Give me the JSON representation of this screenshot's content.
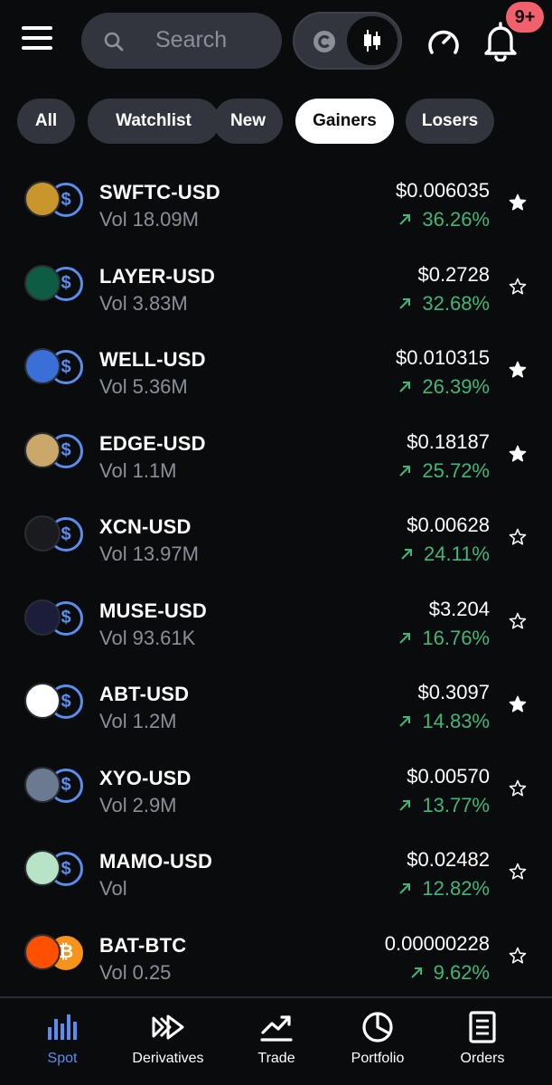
{
  "header": {
    "search_placeholder": "Search",
    "notification_badge": "9+",
    "icons": [
      "menu-icon",
      "search-icon",
      "coin-c-icon",
      "candlestick-icon",
      "gauge-icon",
      "bell-icon"
    ]
  },
  "filters": [
    {
      "label": "All",
      "active": false
    },
    {
      "label": "Watchlist",
      "active": false
    },
    {
      "label": "New",
      "active": false
    },
    {
      "label": "Gainers",
      "active": true
    },
    {
      "label": "Losers",
      "active": false
    }
  ],
  "markets": [
    {
      "pair": "SWFTC-USD",
      "vol_label": "Vol",
      "volume": "18.09M",
      "price": "$0.006035",
      "change": "36.26%",
      "starred": true,
      "coin_color": "#c8962a",
      "quote": "usd"
    },
    {
      "pair": "LAYER-USD",
      "vol_label": "Vol",
      "volume": "3.83M",
      "price": "$0.2728",
      "change": "32.68%",
      "starred": false,
      "coin_color": "#0f5c45",
      "quote": "usd"
    },
    {
      "pair": "WELL-USD",
      "vol_label": "Vol",
      "volume": "5.36M",
      "price": "$0.010315",
      "change": "26.39%",
      "starred": true,
      "coin_color": "#3a6fd8",
      "quote": "usd"
    },
    {
      "pair": "EDGE-USD",
      "vol_label": "Vol",
      "volume": "1.1M",
      "price": "$0.18187",
      "change": "25.72%",
      "starred": true,
      "coin_color": "#c9a86a",
      "quote": "usd"
    },
    {
      "pair": "XCN-USD",
      "vol_label": "Vol",
      "volume": "13.97M",
      "price": "$0.00628",
      "change": "24.11%",
      "starred": false,
      "coin_color": "#1a1b1f",
      "quote": "usd"
    },
    {
      "pair": "MUSE-USD",
      "vol_label": "Vol",
      "volume": "93.61K",
      "price": "$3.204",
      "change": "16.76%",
      "starred": false,
      "coin_color": "#1c1d3a",
      "quote": "usd"
    },
    {
      "pair": "ABT-USD",
      "vol_label": "Vol",
      "volume": "1.2M",
      "price": "$0.3097",
      "change": "14.83%",
      "starred": true,
      "coin_color": "#ffffff",
      "quote": "usd"
    },
    {
      "pair": "XYO-USD",
      "vol_label": "Vol",
      "volume": "2.9M",
      "price": "$0.00570",
      "change": "13.77%",
      "starred": false,
      "coin_color": "#6b7a90",
      "quote": "usd"
    },
    {
      "pair": "MAMO-USD",
      "vol_label": "Vol",
      "volume": "",
      "price": "$0.02482",
      "change": "12.82%",
      "starred": false,
      "coin_color": "#b7e4c7",
      "quote": "usd"
    },
    {
      "pair": "BAT-BTC",
      "vol_label": "Vol",
      "volume": "0.25",
      "price": "0.00000228",
      "change": "9.62%",
      "starred": false,
      "coin_color": "#ff5000",
      "quote": "btc"
    }
  ],
  "colors": {
    "background": "#0a0b0d",
    "surface": "#32353d",
    "positive": "#3fb67a",
    "accent": "#5b8def",
    "badge": "#f0616d"
  },
  "bottom_nav": [
    {
      "label": "Spot",
      "icon": "bar-chart-icon",
      "active": true
    },
    {
      "label": "Derivatives",
      "icon": "fast-forward-icon",
      "active": false
    },
    {
      "label": "Trade",
      "icon": "trend-up-icon",
      "active": false
    },
    {
      "label": "Portfolio",
      "icon": "pie-chart-icon",
      "active": false
    },
    {
      "label": "Orders",
      "icon": "document-icon",
      "active": false
    }
  ]
}
